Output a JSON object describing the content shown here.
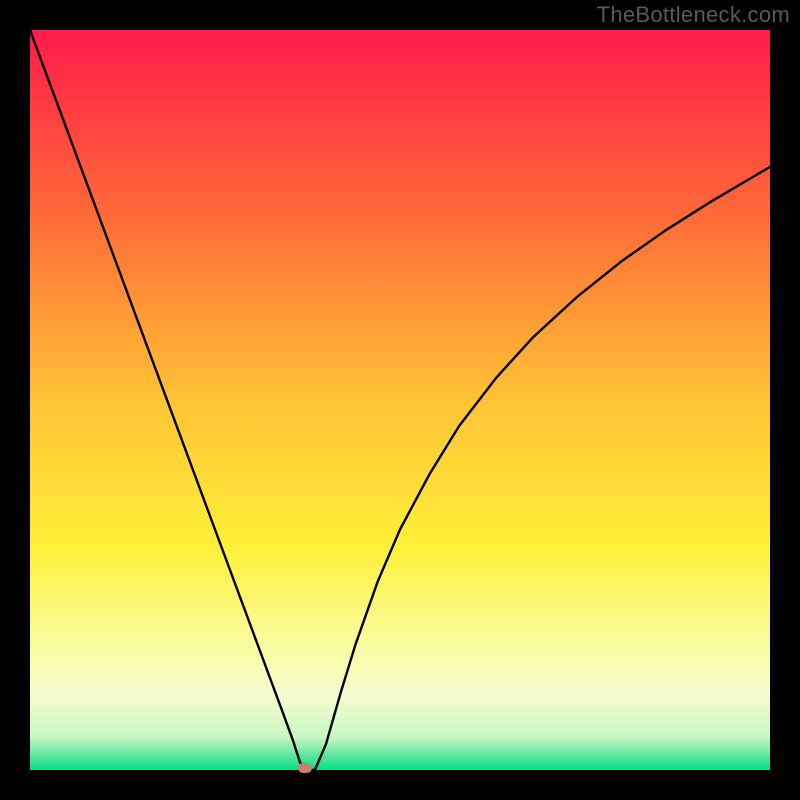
{
  "watermark": "TheBottleneck.com",
  "chart_data": {
    "type": "line",
    "title": "",
    "xlabel": "",
    "ylabel": "",
    "xlim": [
      0,
      100
    ],
    "ylim": [
      0,
      100
    ],
    "grid": false,
    "legend": false,
    "annotations": [],
    "background_gradient": {
      "stops": [
        {
          "offset": 0,
          "color": "#ff1a4b"
        },
        {
          "offset": 0.25,
          "color": "#ff6a38"
        },
        {
          "offset": 0.5,
          "color": "#ffc335"
        },
        {
          "offset": 0.7,
          "color": "#fff038"
        },
        {
          "offset": 0.82,
          "color": "#fbfb99"
        },
        {
          "offset": 0.9,
          "color": "#f4fccf"
        },
        {
          "offset": 0.955,
          "color": "#c8f7c1"
        },
        {
          "offset": 0.985,
          "color": "#48e49a"
        },
        {
          "offset": 1.0,
          "color": "#00de88"
        }
      ]
    },
    "series": [
      {
        "name": "curve",
        "color": "#000000",
        "x": [
          0,
          4,
          8,
          12,
          16,
          20,
          24,
          28,
          32,
          34,
          35.5,
          36.5,
          37.5,
          38.5,
          40,
          42,
          44,
          47,
          50,
          54,
          58,
          63,
          68,
          74,
          80,
          86,
          92,
          100
        ],
        "values": [
          100,
          89.2,
          78.4,
          67.6,
          56.8,
          46.0,
          35.2,
          24.4,
          13.6,
          8.2,
          4.1,
          1.0,
          0.0,
          0.0,
          3.5,
          10.5,
          17.0,
          25.5,
          32.5,
          40.0,
          46.5,
          53.0,
          58.5,
          64.0,
          68.8,
          73.0,
          76.8,
          81.5
        ]
      }
    ],
    "marker": {
      "x": 37.2,
      "y": 0.3,
      "color": "#cf7d72"
    }
  }
}
